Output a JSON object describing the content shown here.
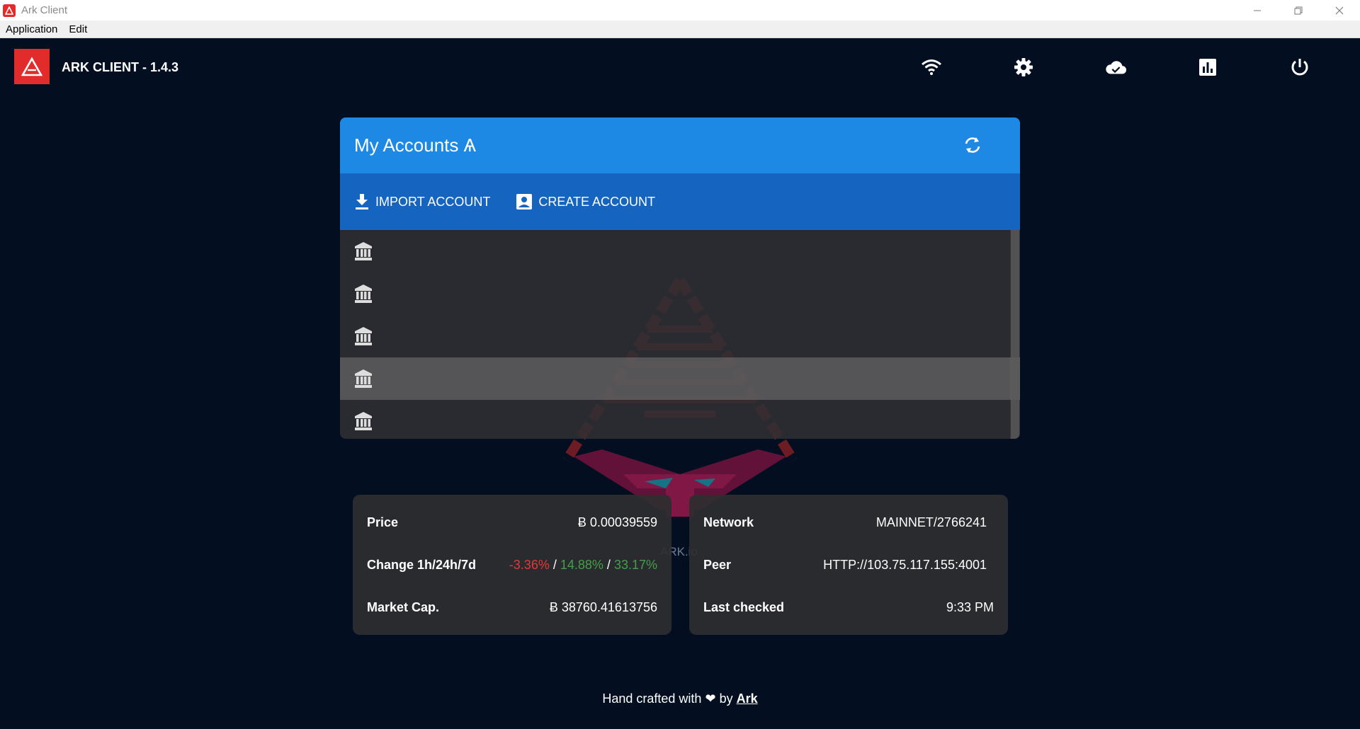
{
  "window": {
    "title": "Ark Client",
    "controls": [
      "minimize",
      "restore",
      "close"
    ]
  },
  "menubar": {
    "items": [
      "Application",
      "Edit"
    ]
  },
  "header": {
    "app_title": "ARK CLIENT - 1.4.3",
    "icons": [
      "wifi-icon",
      "settings-icon",
      "cloud-done-icon",
      "chart-icon",
      "power-icon"
    ]
  },
  "accounts": {
    "title": "My Accounts Ѧ",
    "import_label": "IMPORT ACCOUNT",
    "create_label": "CREATE ACCOUNT",
    "rows": [
      {
        "highlighted": false
      },
      {
        "highlighted": false
      },
      {
        "highlighted": false
      },
      {
        "highlighted": true
      },
      {
        "highlighted": false
      }
    ]
  },
  "market": {
    "price_label": "Price",
    "price_value": "Ƀ 0.00039559",
    "change_label": "Change 1h/24h/7d",
    "change_1h": "-3.36%",
    "change_24h": "14.88%",
    "change_7d": "33.17%",
    "separator": " / ",
    "marketcap_label": "Market Cap.",
    "marketcap_value": "Ƀ 38760.41613756"
  },
  "network": {
    "network_label": "Network",
    "network_value": "MAINNET/2766241",
    "peer_label": "Peer",
    "peer_value": "HTTP://103.75.117.155:4001",
    "checked_label": "Last checked",
    "checked_value": "9:33 PM"
  },
  "watermark": {
    "text": "ARK.io"
  },
  "footer": {
    "text_before": "Hand crafted with",
    "heart": "❤",
    "text_by": "by",
    "link": "Ark"
  },
  "colors": {
    "accent": "#1e88e5",
    "accent_dark": "#1565c0",
    "brand": "#e22b2b",
    "background": "#030f21",
    "negative": "#e53935",
    "positive": "#43a047"
  }
}
